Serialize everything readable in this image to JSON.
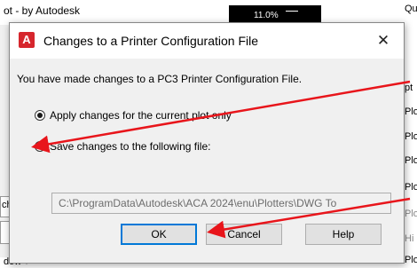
{
  "background": {
    "app_title": "ot - by Autodesk",
    "zoom_value": "11.0%",
    "right_panel_items": [
      "Qualit",
      "pt",
      "Plo",
      "Plo",
      "Plo",
      "Plo",
      "Plo",
      "Hi",
      "Plo"
    ],
    "left_fragment": "ch",
    "bottom_fragment": "dow ▾"
  },
  "dialog": {
    "title": "Changes to a Printer Configuration File",
    "icon_letter": "A",
    "close_glyph": "✕",
    "message": "You have made changes to a PC3 Printer Configuration File.",
    "options": [
      {
        "label": "Apply changes for the current plot only",
        "checked": true
      },
      {
        "label": "Save changes to the following file:",
        "checked": false
      }
    ],
    "file_path": "C:\\ProgramData\\Autodesk\\ACA 2024\\enu\\Plotters\\DWG To",
    "buttons": {
      "ok": "OK",
      "cancel": "Cancel",
      "help": "Help"
    }
  },
  "annotations": {
    "arrow_color": "#e8151b",
    "accent_color": "#0078d7",
    "icon_color": "#d6262d"
  }
}
